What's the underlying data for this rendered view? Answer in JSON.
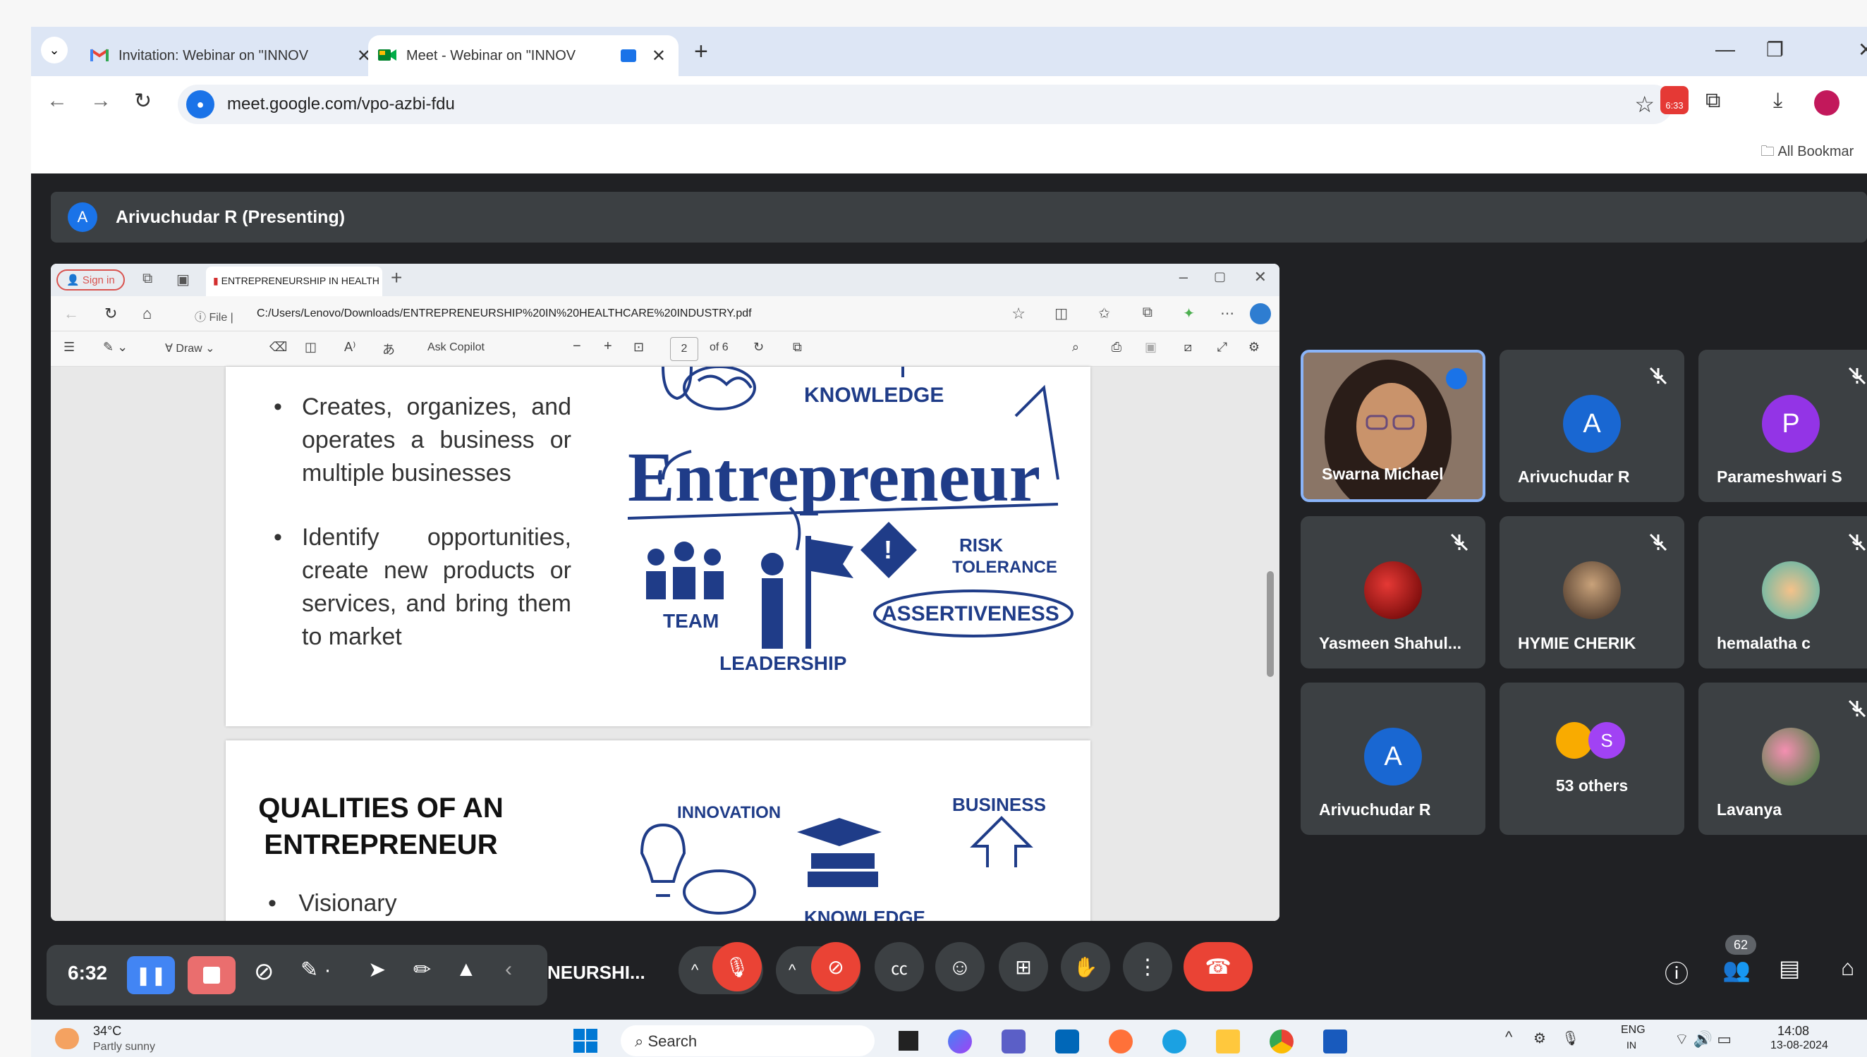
{
  "tabs": [
    {
      "label": "Invitation: Webinar on \"INNOV",
      "icon": "gmail-icon"
    },
    {
      "label": "Meet - Webinar on \"INNOV",
      "icon": "meet-icon"
    }
  ],
  "address": {
    "url": "meet.google.com/vpo-azbi-fdu"
  },
  "bookmarks": {
    "all": "All Bookmar"
  },
  "ext_badge": "6:33",
  "presenting": {
    "initial": "A",
    "label": "Arivuchudar R (Presenting)"
  },
  "edge": {
    "signin": "Sign in",
    "tab_title": "ENTREPRENEURSHIP IN HEALTH",
    "file_label": "File",
    "path": "C:/Users/Lenovo/Downloads/ENTREPRENEURSHIP%20IN%20HEALTHCARE%20INDUSTRY.pdf",
    "draw": "Draw",
    "ask_copilot": "Ask Copilot",
    "page_num": "2",
    "page_of": "of 6"
  },
  "slide1": {
    "bullets": [
      "Creates, organizes, and operates a business or multiple businesses",
      "Identify opportunities, create new products or services, and bring them to market"
    ],
    "graphic": {
      "title": "Entrepreneur",
      "knowledge": "KNOWLEDGE",
      "risk": "RISK TOLERANCE",
      "team": "TEAM",
      "leadership": "LEADERSHIP",
      "assertiveness": "ASSERTIVENESS"
    }
  },
  "slide2": {
    "heading_line1": "QUALITIES OF AN",
    "heading_line2": "ENTREPRENEUR",
    "first_item": "Visionary",
    "graphic": {
      "innovation": "INNOVATION",
      "business": "BUSINESS",
      "knowledge": "KNOWLEDGE"
    }
  },
  "participants": [
    {
      "name": "Swarna Michael",
      "type": "video"
    },
    {
      "name": "Arivuchudar R",
      "initial": "A",
      "color": "#1967d2"
    },
    {
      "name": "Parameshwari S",
      "initial": "P",
      "color": "#9334e6"
    },
    {
      "name": "Yasmeen Shahul...",
      "type": "photo"
    },
    {
      "name": "HYMIE CHERIK",
      "type": "photo"
    },
    {
      "name": "hemalatha c",
      "type": "photo"
    },
    {
      "name": "Arivuchudar R",
      "initial": "A",
      "color": "#1967d2"
    },
    {
      "name": "53 others",
      "initial": "S"
    },
    {
      "name": "Lavanya",
      "type": "photo"
    }
  ],
  "recording": {
    "time": "6:32"
  },
  "meeting_title": "NEURSHI...",
  "people_count": "62",
  "taskbar": {
    "temp": "34°C",
    "weather": "Partly sunny",
    "search": "Search",
    "lang": "ENG",
    "lang2": "IN",
    "time": "14:08",
    "date": "13-08-2024"
  }
}
